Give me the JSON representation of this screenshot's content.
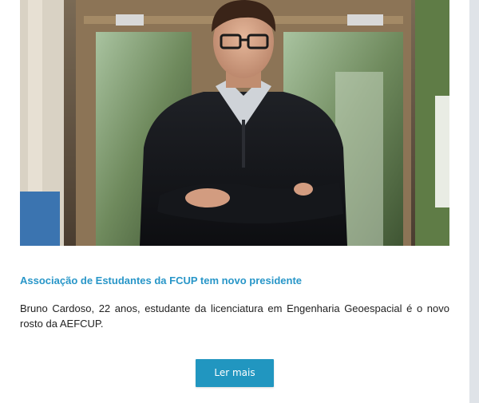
{
  "article": {
    "image_alt": "Bruno Cardoso",
    "title": "Associação de Estudantes da FCUP tem novo presidente",
    "summary": "Bruno Cardoso, 22 anos, estudante da licenciatura em Engenharia Geoespacial é o novo rosto da AEFCUP.",
    "read_more_label": "Ler mais"
  },
  "colors": {
    "title": "#2896c8",
    "button": "#2196c0",
    "scroll_track": "#dfe3e8"
  }
}
